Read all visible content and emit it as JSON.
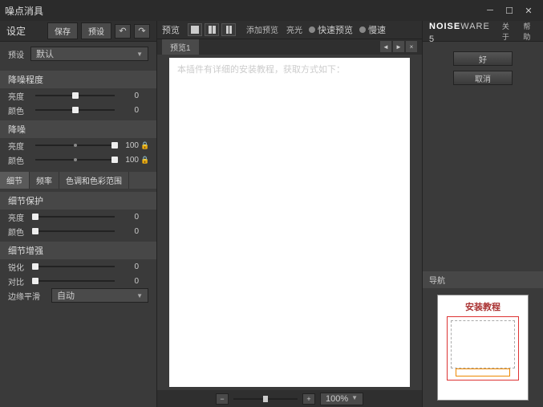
{
  "window": {
    "title": "噪点消具"
  },
  "left": {
    "header": "设定",
    "buttons": {
      "save": "保存",
      "preset": "预设"
    },
    "preset_label": "预设",
    "preset_value": "默认",
    "sec_noise_level": "降噪程度",
    "sec_noise_reduce": "降噪",
    "sliders": {
      "luminance": {
        "label": "亮度",
        "value": "0"
      },
      "color": {
        "label": "颜色",
        "value": "0"
      },
      "luminance2": {
        "label": "亮度",
        "value": "100"
      },
      "color2": {
        "label": "颜色",
        "value": "100"
      }
    },
    "tabs": {
      "detail": "细节",
      "freq": "频率",
      "tone": "色调和色彩范围"
    },
    "sec_detail_protect": "细节保护",
    "sliders2": {
      "luminance": {
        "label": "亮度",
        "value": "0"
      },
      "color": {
        "label": "颜色",
        "value": "0"
      }
    },
    "sec_detail_enhance": "细节增强",
    "sliders3": {
      "sharpen": {
        "label": "锐化",
        "value": "0"
      },
      "contrast": {
        "label": "对比",
        "value": "0"
      },
      "edge": {
        "label": "边缘平滑",
        "value": "自动"
      }
    }
  },
  "center": {
    "header": "预览",
    "links": {
      "add": "添加预览",
      "highlight": "亮光",
      "fast": "快速预览",
      "slow": "慢速"
    },
    "doc_tab": "预览1",
    "page_text": "本插件有详细的安装教程，获取方式如下：",
    "zoom": "100%"
  },
  "right": {
    "brand_bold": "NOISE",
    "brand_light": "WARE",
    "brand_ver": "5",
    "about": "关于",
    "help": "帮助",
    "apply": "好",
    "cancel": "取消",
    "nav_header": "导航",
    "thumb_title": "安装教程"
  }
}
